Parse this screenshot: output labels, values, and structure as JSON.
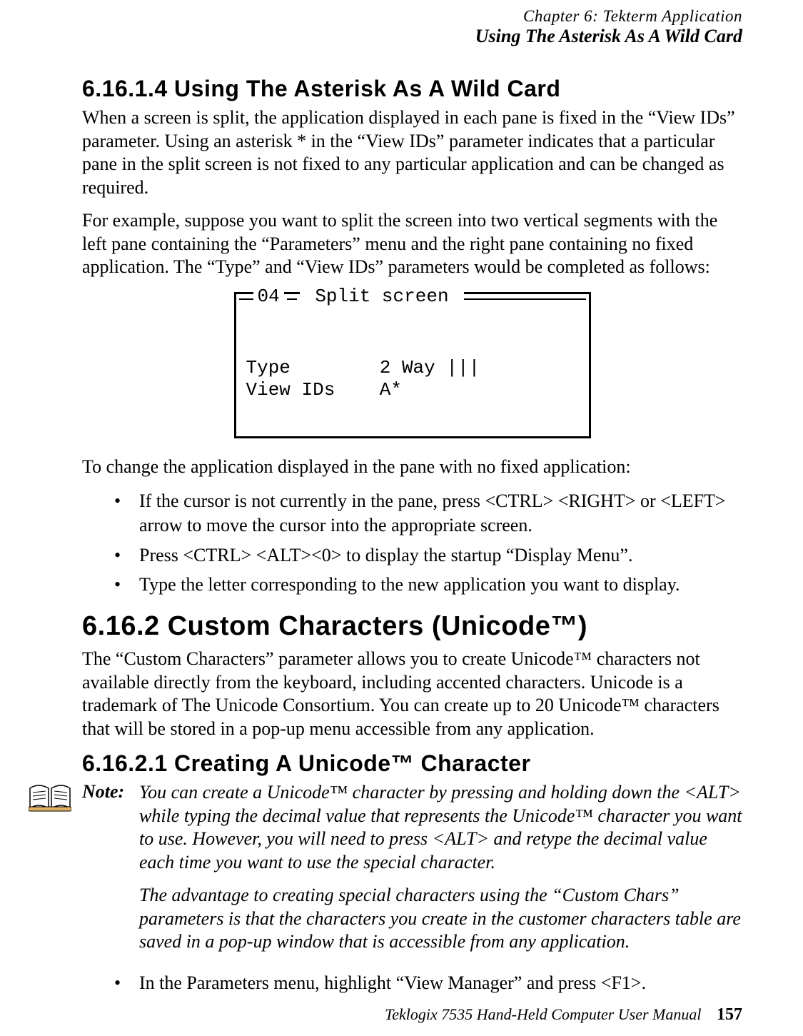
{
  "header": {
    "chapter": "Chapter  6:  Tekterm Application",
    "section": "Using The Asterisk As A Wild Card"
  },
  "h_6_16_1_4": "6.16.1.4  Using The Asterisk As A Wild Card",
  "p1": "When a screen is split, the application displayed in each pane is fixed in the “View IDs” parameter. Using an asterisk * in the “View IDs” parameter indicates that a particular pane in the split screen is not fixed to any particular application and can be changed as required.",
  "p2": "For example, suppose you want to split the screen into two vertical segments with the left pane containing the “Parameters” menu and the right pane containing no fixed application. The “Type” and “View IDs” parameters would be completed as follows:",
  "terminal": {
    "title_num": "04",
    "title_text": " Split screen ",
    "row1_left": "Type",
    "row1_right": "2 Way |||",
    "row2_left": "View IDs",
    "row2_right": "A*"
  },
  "p3": "To change the application displayed in the pane with no fixed application:",
  "bullets1": [
    "If the cursor is not currently in the pane, press <CTRL> <RIGHT> or <LEFT> arrow to move the cursor into the appropriate screen.",
    "Press <CTRL> <ALT><0> to display the startup “Display Menu”.",
    "Type the letter corresponding to the new application you want to display."
  ],
  "h_6_16_2": "6.16.2  Custom Characters (Unicode™)",
  "p4": "The “Custom Characters” parameter allows you to create Unicode™ characters not available directly from the keyboard, including accented characters. Unicode is a trademark of The Unicode Consortium. You can create up to 20 Unicode™ characters that will be stored in a pop-up menu accessible from any application.",
  "h_6_16_2_1": "6.16.2.1   Creating A Unicode™ Character",
  "note": {
    "label": "Note:",
    "para1": "You can create a Unicode™ character by pressing and holding down the <ALT> while typing the decimal value that represents the Unicode™ character you want to use. However, you will need to press <ALT> and retype the decimal value each time you want to use the special character.",
    "para2": "The advantage to creating special characters using the “Custom Chars” parameters is that the characters you create in the customer characters table are saved in a pop-up window that is accessible from any application."
  },
  "bullets2": [
    "In the Parameters menu, highlight “View Manager” and press <F1>."
  ],
  "footer": {
    "manual": "Teklogix 7535 Hand-Held Computer User Manual",
    "page": "157"
  }
}
